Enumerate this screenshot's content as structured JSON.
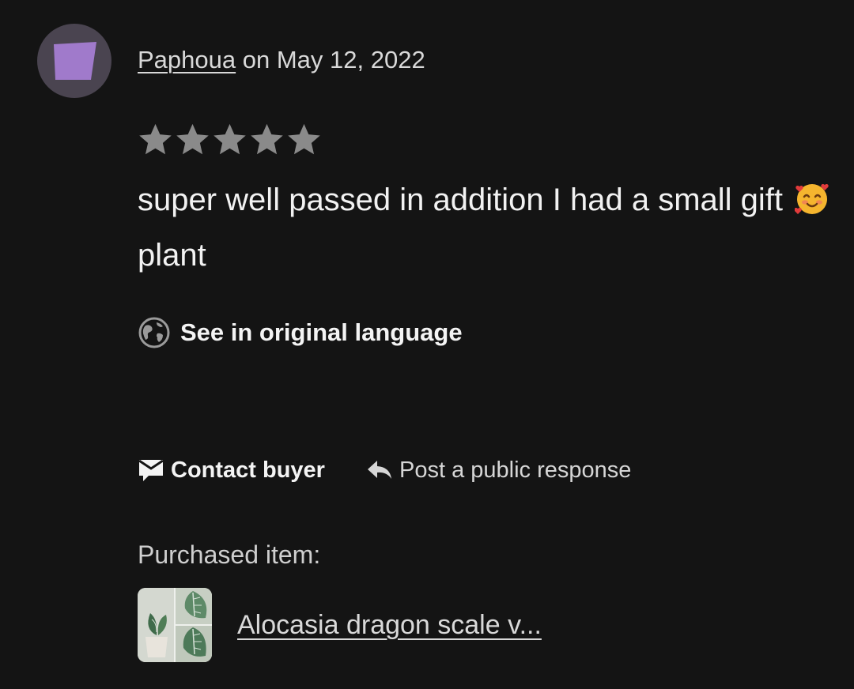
{
  "review": {
    "username": "Paphoua",
    "date_text": "on May 12, 2022",
    "rating": 5,
    "max_rating": 5,
    "text_before_emoji": "super well passed in addition I had a small gift",
    "emoji": "smiling-face-with-hearts",
    "text_after_emoji": "plant"
  },
  "translate": {
    "label": "See in original language",
    "icon": "globe-icon"
  },
  "actions": {
    "contact_label": "Contact buyer",
    "contact_icon": "envelope-icon",
    "respond_label": "Post a public response",
    "respond_icon": "reply-arrow-icon"
  },
  "purchase": {
    "label": "Purchased item:",
    "item_title": "Alocasia dragon scale v..."
  },
  "colors": {
    "background": "#141414",
    "avatar_bg": "#4a4450",
    "avatar_shape": "#a07acb",
    "star": "#8a8a8a"
  }
}
